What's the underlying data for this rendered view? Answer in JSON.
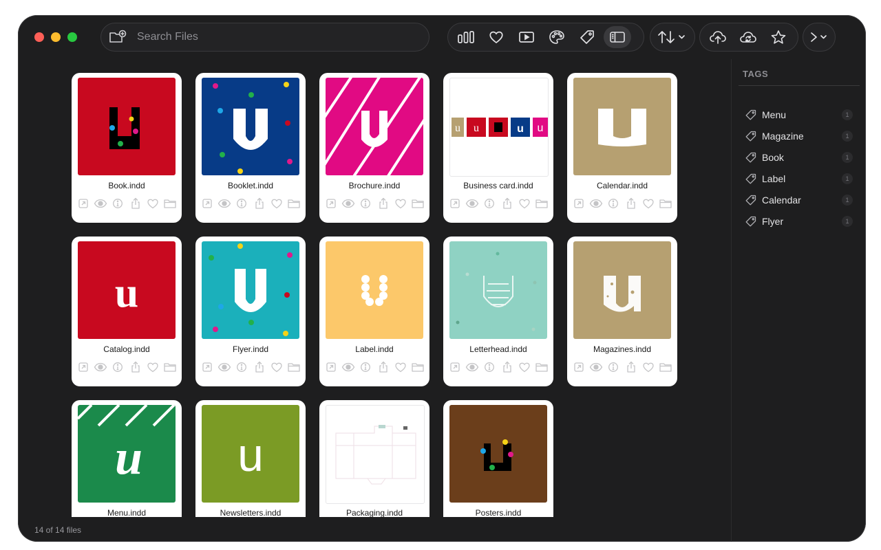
{
  "search": {
    "placeholder": "Search Files"
  },
  "toolbar": {
    "view_icons": [
      "grid-view-icon",
      "favorite-icon",
      "preview-icon",
      "palette-icon",
      "tag-icon",
      "sidebar-icon"
    ],
    "sort_icon": "sort-icon",
    "cloud_icons": [
      "cloud-upload-icon",
      "cloud-sync-icon",
      "star-icon"
    ],
    "more_icon": "more-icon"
  },
  "files": [
    {
      "name": "Book.indd"
    },
    {
      "name": "Booklet.indd"
    },
    {
      "name": "Brochure.indd"
    },
    {
      "name": "Business card.indd"
    },
    {
      "name": "Calendar.indd"
    },
    {
      "name": "Catalog.indd"
    },
    {
      "name": "Flyer.indd"
    },
    {
      "name": "Label.indd"
    },
    {
      "name": "Letterhead.indd"
    },
    {
      "name": "Magazines.indd"
    },
    {
      "name": "Menu.indd"
    },
    {
      "name": "Newsletters.indd"
    },
    {
      "name": "Packaging.indd"
    },
    {
      "name": "Posters.indd"
    }
  ],
  "thumb_colors": [
    "#c8091f",
    "#073b87",
    "#e10a83",
    "#ffffff",
    "#b6a071",
    "#c8091f",
    "#1bb0bb",
    "#fcc86a",
    "#8fd2c3",
    "#b6a071",
    "#1b8a4b",
    "#7b9b25",
    "#ffffff",
    "#6b3e1b"
  ],
  "sidebar": {
    "title": "TAGS",
    "tags": [
      {
        "name": "Menu",
        "count": "1"
      },
      {
        "name": "Magazine",
        "count": "1"
      },
      {
        "name": "Book",
        "count": "1"
      },
      {
        "name": "Label",
        "count": "1"
      },
      {
        "name": "Calendar",
        "count": "1"
      },
      {
        "name": "Flyer",
        "count": "1"
      }
    ]
  },
  "status": {
    "text": "14 of 14 files"
  }
}
